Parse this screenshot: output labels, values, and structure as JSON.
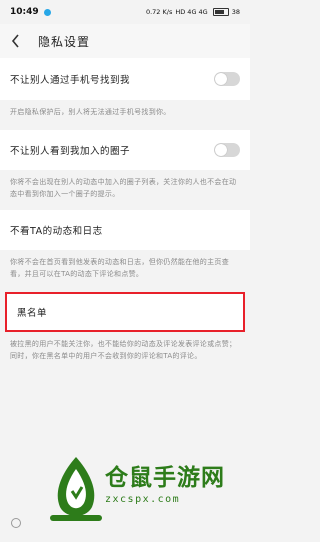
{
  "status_bar": {
    "time": "10:49",
    "speed": "0.72 K/s",
    "network": "HD 4G 4G",
    "battery": "38"
  },
  "header": {
    "title": "隐私设置"
  },
  "settings": [
    {
      "label": "不让别人通过手机号找到我",
      "description": "开启隐私保护后，别人将无法通过手机号找到你。"
    },
    {
      "label": "不让别人看到我加入的圈子",
      "description": "你将不会出现在别人的动态中加入的圈子列表，关注你的人也不会在动态中看到你加入一个圈子的提示。"
    },
    {
      "label": "不看TA的动态和日志",
      "description": "你将不会在首页看到他发表的动态和日志，但你仍然能在他的主页查看，并且可以在TA的动态下评论和点赞。"
    }
  ],
  "blacklist": {
    "label": "黑名单",
    "description": "被拉黑的用户不能关注你，也不能给你的动态及评论发表评论或点赞；同时，你在黑名单中的用户不会收到你的评论和TA的评论。"
  },
  "watermark": {
    "title": "仓鼠手游网",
    "url": "zxcspx.com"
  },
  "colors": {
    "highlight_border": "#e8202a",
    "watermark_green": "#2d7c1a",
    "toggle_off": "#d7d7d7"
  }
}
